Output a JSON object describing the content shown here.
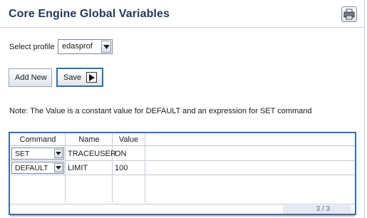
{
  "page": {
    "title": "Core Engine Global Variables",
    "print_icon": "printer-icon"
  },
  "profile": {
    "label": "Select profile",
    "selected": "edasprof"
  },
  "buttons": {
    "add_new": "Add New",
    "save": "Save"
  },
  "note": "Note: The Value is a constant value for DEFAULT and an expression for SET command",
  "grid": {
    "columns": [
      "Command",
      "Name",
      "Value"
    ],
    "rows": [
      {
        "command": "SET",
        "name": "TRACEUSER",
        "value": "ON"
      },
      {
        "command": "DEFAULT",
        "name": "LIMIT",
        "value": "100"
      }
    ],
    "pager": "3 / 3"
  },
  "colors": {
    "title": "#1f3a5c",
    "focus_border": "#2f6fb3"
  }
}
